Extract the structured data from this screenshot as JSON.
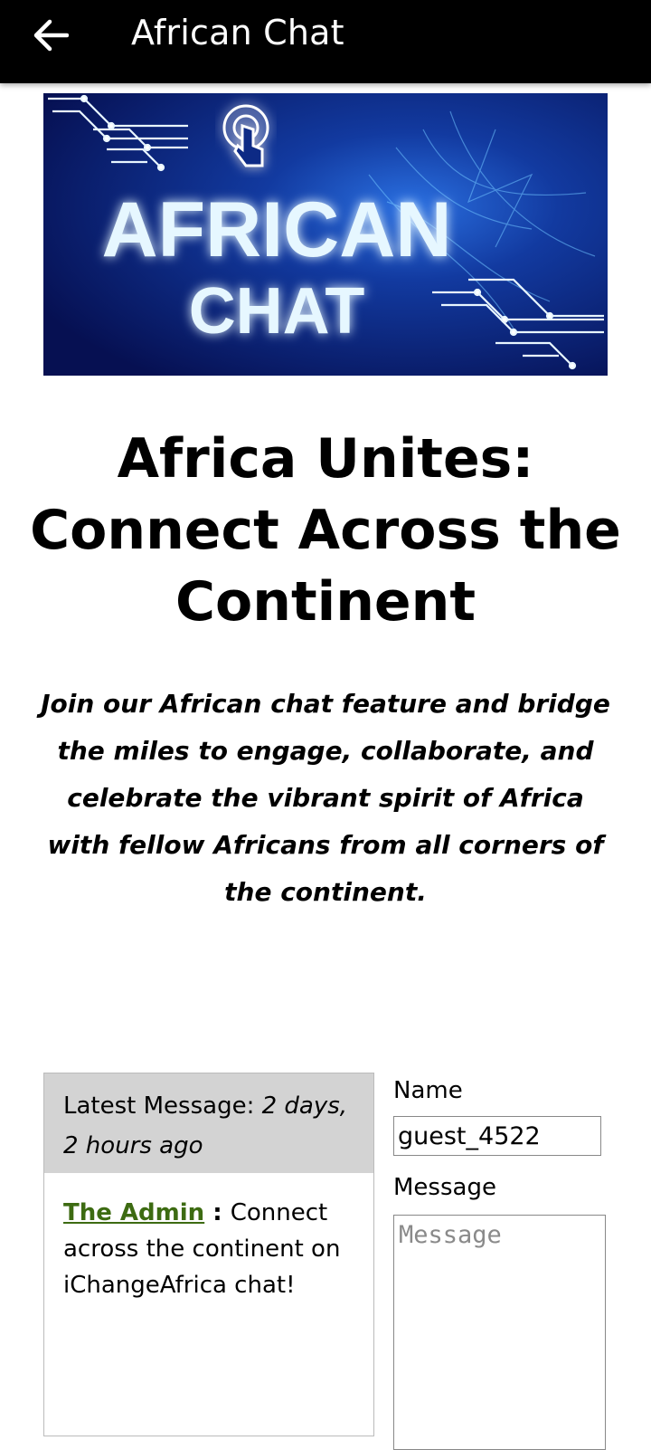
{
  "appbar": {
    "title": "African Chat",
    "back_icon": "arrow-left-icon"
  },
  "banner": {
    "line1": "AFRICAN",
    "line2": "CHAT",
    "icon": "touch-pointer-icon",
    "colors": {
      "background": "#0a1a66",
      "glow": "#4aa8ff",
      "text": "#dff3ff"
    }
  },
  "headline": {
    "line1": "Africa Unites:",
    "line2": "Connect Across the",
    "line3": "Continent"
  },
  "intro": "Join our African chat feature and bridge the miles to engage, collaborate, and celebrate the vibrant spirit of Africa with fellow Africans from all corners of the continent.",
  "messages": {
    "latest_label": "Latest Message: ",
    "latest_time": "2 days, 2 hours ago",
    "author": "The Admin",
    "separator": " : ",
    "text": "Connect across the continent on iChangeAfrica chat!",
    "author_color": "#3d6b12"
  },
  "form": {
    "name_label": "Name",
    "name_value": "guest_4522",
    "message_label": "Message",
    "message_placeholder": "Message"
  }
}
